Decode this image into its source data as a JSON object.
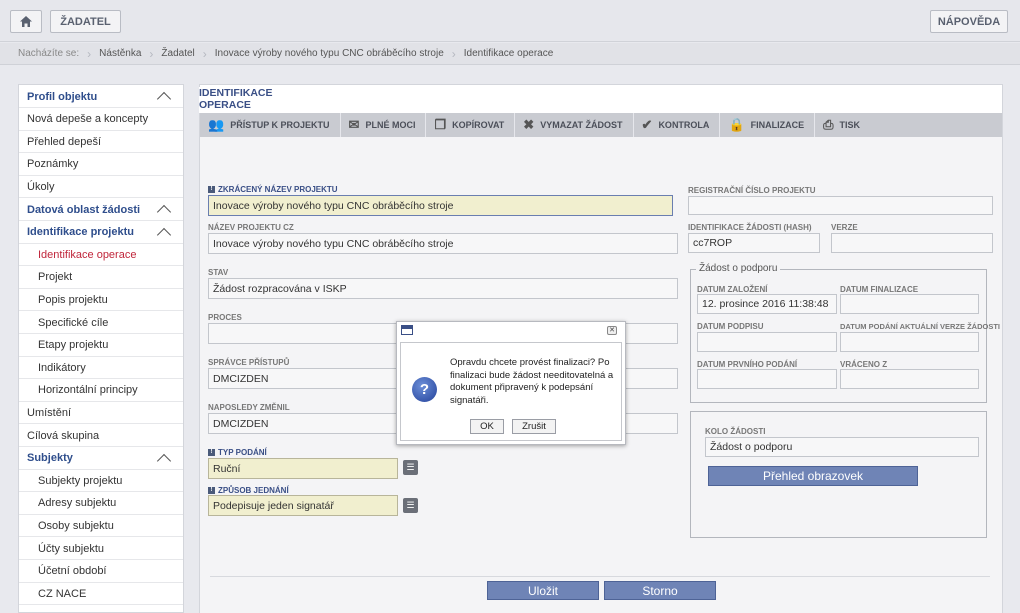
{
  "topbar": {
    "applicant_label": "ŽADATEL",
    "help_label": "NÁPOVĚDA"
  },
  "breadcrumb": {
    "prefix": "Nacházíte se:",
    "items": [
      "Nástěnka",
      "Žadatel",
      "Inovace výroby nového typu CNC obráběcího stroje",
      "Identifikace operace"
    ]
  },
  "sidebar": {
    "items": [
      {
        "label": "Profil objektu",
        "type": "section"
      },
      {
        "label": "Nová depeše a koncepty",
        "type": "item"
      },
      {
        "label": "Přehled depeší",
        "type": "item"
      },
      {
        "label": "Poznámky",
        "type": "item"
      },
      {
        "label": "Úkoly",
        "type": "item"
      },
      {
        "label": "Datová oblast žádosti",
        "type": "section"
      },
      {
        "label": "Identifikace projektu",
        "type": "section"
      },
      {
        "label": "Identifikace operace",
        "type": "active"
      },
      {
        "label": "Projekt",
        "type": "sub"
      },
      {
        "label": "Popis projektu",
        "type": "sub"
      },
      {
        "label": "Specifické cíle",
        "type": "sub"
      },
      {
        "label": "Etapy projektu",
        "type": "sub"
      },
      {
        "label": "Indikátory",
        "type": "sub"
      },
      {
        "label": "Horizontální principy",
        "type": "sub"
      },
      {
        "label": "Umístění",
        "type": "item"
      },
      {
        "label": "Cílová skupina",
        "type": "item"
      },
      {
        "label": "Subjekty",
        "type": "section"
      },
      {
        "label": "Subjekty projektu",
        "type": "sub"
      },
      {
        "label": "Adresy subjektu",
        "type": "sub"
      },
      {
        "label": "Osoby subjektu",
        "type": "sub"
      },
      {
        "label": "Účty subjektu",
        "type": "sub"
      },
      {
        "label": "Účetní období",
        "type": "sub"
      },
      {
        "label": "CZ NACE",
        "type": "sub"
      }
    ]
  },
  "main": {
    "tab_title": "IDENTIFIKACE OPERACE",
    "toolbar": [
      "PŘÍSTUP K PROJEKTU",
      "PLNÉ MOCI",
      "KOPÍROVAT",
      "VYMAZAT ŽÁDOST",
      "KONTROLA",
      "FINALIZACE",
      "TISK"
    ],
    "fields": {
      "short_name_label": "ZKRÁCENÝ NÁZEV PROJEKTU",
      "short_name_value": "Inovace výroby nového typu CNC obráběcího stroje",
      "name_cz_label": "NÁZEV PROJEKTU CZ",
      "name_cz_value": "Inovace výroby nového typu CNC obráběcího stroje",
      "state_label": "STAV",
      "state_value": "Žádost rozpracována v ISKP",
      "process_label": "PROCES",
      "admin_label": "SPRÁVCE PŘÍSTUPŮ",
      "admin_value": "DMCIZDEN",
      "last_changed_label": "NAPOSLEDY ZMĚNIL",
      "last_changed_value": "DMCIZDEN",
      "submission_type_label": "TYP PODÁNÍ",
      "submission_type_value": "Ruční",
      "acting_label": "ZPŮSOB JEDNÁNÍ",
      "acting_value": "Podepisuje jeden signatář",
      "reg_no_label": "REGISTRAČNÍ ČÍSLO PROJEKTU",
      "hash_label": "IDENTIFIKACE ŽÁDOSTI (HASH)",
      "hash_value": "cc7ROP",
      "version_label": "VERZE",
      "support_group_label": "Žádost o podporu",
      "created_label": "DATUM ZALOŽENÍ",
      "created_value": "12. prosince 2016 11:38:48",
      "finalized_label": "DATUM FINALIZACE",
      "signed_label": "DATUM PODPISU",
      "latest_submit_label": "DATUM PODÁNÍ AKTUÁLNÍ VERZE ŽÁDOSTI",
      "first_submit_label": "DATUM PRVNÍHO PODÁNÍ",
      "returned_label": "VRÁCENO Z",
      "round_label": "KOLO ŽÁDOSTI",
      "round_value": "Žádost o podporu",
      "screens_button": "Přehled obrazovek"
    },
    "save_label": "Uložit",
    "cancel_label": "Storno"
  },
  "dialog": {
    "message": "Opravdu chcete provést finalizaci? Po finalizaci bude žádost needitovatelná a dokument připravený k podepsání signatáři.",
    "ok_label": "OK",
    "cancel_label": "Zrušit"
  }
}
